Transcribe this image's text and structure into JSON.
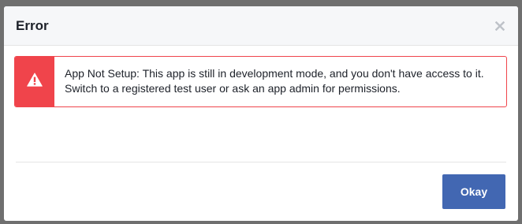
{
  "dialog": {
    "title": "Error",
    "close_icon": "close-icon",
    "alert": {
      "icon": "warning-icon",
      "message": "App Not Setup: This app is still in development mode, and you don't have access to it. Switch to a registered test user or ask an app admin for permissions."
    },
    "okay_label": "Okay"
  },
  "colors": {
    "header_bg": "#f6f7f9",
    "alert_red": "#f0444b",
    "button_blue": "#4267b2",
    "text": "#1d2129",
    "overlay": "#6f6f6f"
  }
}
